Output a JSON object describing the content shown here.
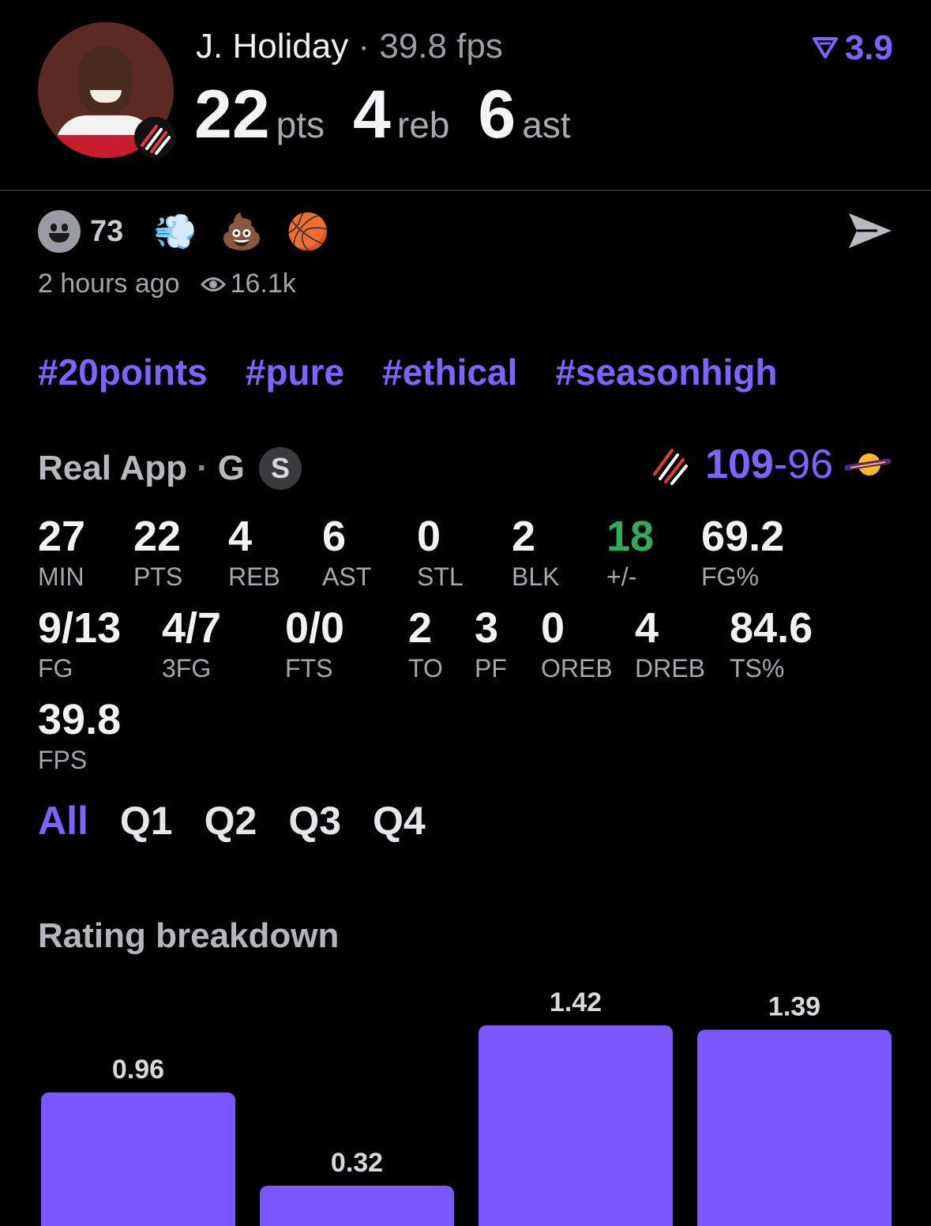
{
  "header": {
    "player_name": "J. Holiday",
    "separator": "·",
    "fps_text": "39.8 fps",
    "pts": "22",
    "pts_label": "pts",
    "reb": "4",
    "reb_label": "reb",
    "ast": "6",
    "ast_label": "ast",
    "rating": "3.9"
  },
  "reactions": {
    "smiley_count": "73",
    "emojis": [
      "💨",
      "💩",
      "🏀"
    ]
  },
  "meta": {
    "time_ago": "2 hours ago",
    "views": "16.1k"
  },
  "hashtags": [
    "#20points",
    "#pure",
    "#ethical",
    "#seasonhigh"
  ],
  "source": {
    "name": "Real App",
    "dot": "·",
    "position": "G",
    "badge": "S"
  },
  "score": {
    "home": "109",
    "dash": "-",
    "away": "96"
  },
  "stats_row1": [
    {
      "v": "27",
      "l": "MIN"
    },
    {
      "v": "22",
      "l": "PTS"
    },
    {
      "v": "4",
      "l": "REB"
    },
    {
      "v": "6",
      "l": "AST"
    },
    {
      "v": "0",
      "l": "STL"
    },
    {
      "v": "2",
      "l": "BLK"
    },
    {
      "v": "18",
      "l": "+/-"
    },
    {
      "v": "69.2",
      "l": "FG%"
    }
  ],
  "stats_row2": [
    {
      "v": "9/13",
      "l": "FG"
    },
    {
      "v": "4/7",
      "l": "3FG"
    },
    {
      "v": "0/0",
      "l": "FTS"
    },
    {
      "v": "2",
      "l": "TO"
    },
    {
      "v": "3",
      "l": "PF"
    },
    {
      "v": "0",
      "l": "OREB"
    },
    {
      "v": "4",
      "l": "DREB"
    },
    {
      "v": "84.6",
      "l": "TS%"
    }
  ],
  "stats_row3": [
    {
      "v": "39.8",
      "l": "FPS"
    }
  ],
  "tabs": [
    "All",
    "Q1",
    "Q2",
    "Q3",
    "Q4"
  ],
  "section_title": "Rating breakdown",
  "colors": {
    "accent": "#8063ff",
    "bar": "#7b57ff",
    "positive": "#2ead5e",
    "background": "#000000"
  },
  "chart_data": {
    "type": "bar",
    "categories": [
      "",
      "",
      "",
      ""
    ],
    "values": [
      0.96,
      0.32,
      1.42,
      1.39
    ],
    "title": "",
    "xlabel": "",
    "ylabel": "",
    "ylim": [
      0,
      1.42
    ],
    "grid": false
  }
}
